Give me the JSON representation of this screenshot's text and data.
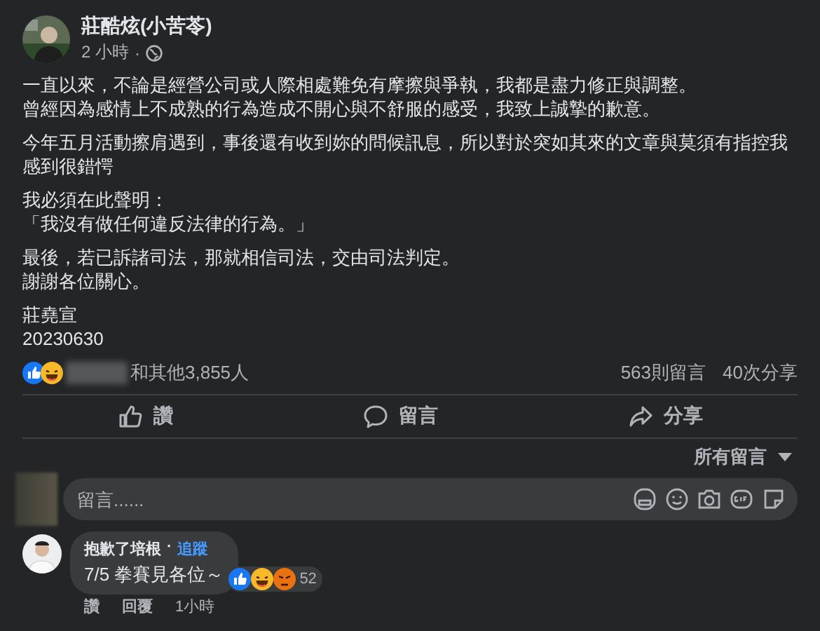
{
  "post": {
    "author": "莊酷炫(小苦苓)",
    "time": "2 小時",
    "separator": "·",
    "paragraphs": [
      {
        "lines": [
          "一直以來，不論是經營公司或人際相處難免有摩擦與爭執，我都是盡力修正與調整。",
          "曾經因為感情上不成熟的行為造成不開心與不舒服的感受，我致上誠摯的歉意。"
        ]
      },
      {
        "lines": [
          "今年五月活動擦肩遇到，事後還有收到妳的問候訊息，所以對於突如其來的文章與莫須有指控我感到很錯愕"
        ]
      },
      {
        "lines": [
          "我必須在此聲明：",
          "「我沒有做任何違反法律的行為。」"
        ]
      },
      {
        "lines": [
          "最後，若已訴諸司法，那就相信司法，交由司法判定。",
          "謝謝各位關心。"
        ]
      },
      {
        "lines": [
          "莊堯宣",
          "20230630"
        ]
      }
    ]
  },
  "reactions": {
    "others": "和其他3,855人",
    "comments": "563則留言",
    "shares": "40次分享"
  },
  "actions": [
    {
      "kind": "like",
      "label": "讚"
    },
    {
      "kind": "comment",
      "label": "留言"
    },
    {
      "kind": "share",
      "label": "分享"
    }
  ],
  "sort": "所有留言",
  "composer": {
    "placeholder": "留言......"
  },
  "comments": [
    {
      "author": "抱歉了培根",
      "separator": "·",
      "follow": "追蹤",
      "text": "7/5 拳賽見各位～",
      "reaction_count": "52",
      "links": [
        "讚",
        "回覆"
      ],
      "time": "1小時"
    }
  ]
}
